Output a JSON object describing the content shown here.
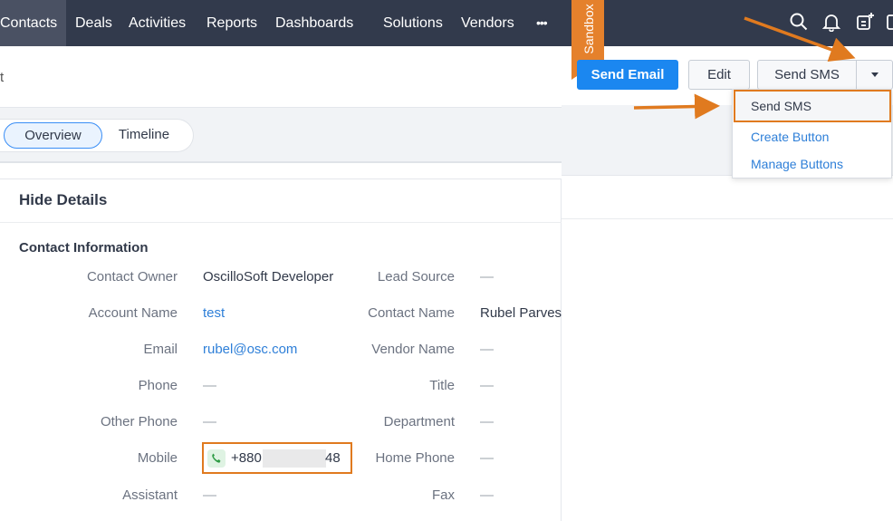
{
  "nav": {
    "items": [
      "Contacts",
      "Deals",
      "Activities",
      "Reports",
      "Dashboards",
      "Solutions",
      "Vendors"
    ],
    "more": "•••",
    "active": "Contacts",
    "icons": [
      "search-icon",
      "bell-icon",
      "add-note-icon",
      "window-icon"
    ]
  },
  "sandbox": {
    "label": "Sandbox"
  },
  "breadcrumb": {
    "fragment": "t"
  },
  "tabs": {
    "overview": "Overview",
    "timeline": "Timeline",
    "active": "Overview"
  },
  "actions": {
    "send_email": "Send Email",
    "edit": "Edit",
    "send_sms": "Send SMS"
  },
  "dropdown": {
    "items": [
      "Send SMS",
      "Create Button",
      "Manage Buttons"
    ],
    "highlighted": "Send SMS"
  },
  "details": {
    "toggle": "Hide Details",
    "section": "Contact Information",
    "left": [
      {
        "label": "Contact Owner",
        "value": "OscilloSoft Developer",
        "kind": "text"
      },
      {
        "label": "Account Name",
        "value": "test",
        "kind": "link"
      },
      {
        "label": "Email",
        "value": "rubel@osc.com",
        "kind": "link"
      },
      {
        "label": "Phone",
        "value": "—",
        "kind": "empty"
      },
      {
        "label": "Other Phone",
        "value": "—",
        "kind": "empty"
      },
      {
        "label": "Mobile",
        "value_prefix": "+880",
        "value_suffix": "48",
        "kind": "masked-phone"
      },
      {
        "label": "Assistant",
        "value": "—",
        "kind": "empty"
      }
    ],
    "right": [
      {
        "label": "Lead Source",
        "value": "—",
        "kind": "empty"
      },
      {
        "label": "Contact Name",
        "value": "Rubel Parves",
        "kind": "text"
      },
      {
        "label": "Vendor Name",
        "value": "—",
        "kind": "empty"
      },
      {
        "label": "Title",
        "value": "—",
        "kind": "empty"
      },
      {
        "label": "Department",
        "value": "—",
        "kind": "empty"
      },
      {
        "label": "Home Phone",
        "value": "—",
        "kind": "empty"
      },
      {
        "label": "Fax",
        "value": "—",
        "kind": "empty"
      }
    ]
  },
  "colors": {
    "nav_bg": "#323a4c",
    "primary": "#1b87f0",
    "link": "#2e7fd8",
    "annotation": "#e07a1f",
    "sandbox": "#e5812c"
  }
}
